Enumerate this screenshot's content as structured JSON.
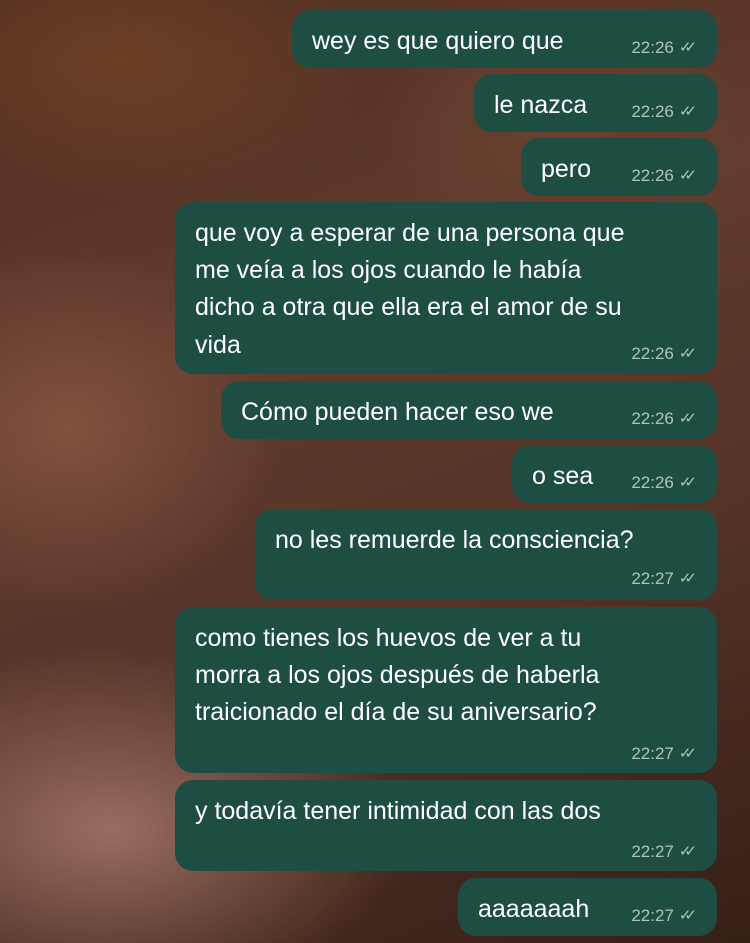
{
  "messages": [
    {
      "text": "wey es que quiero que",
      "time": "22:26",
      "status_icon": "double-check-icon"
    },
    {
      "text": "le nazca",
      "time": "22:26",
      "status_icon": "double-check-icon"
    },
    {
      "text": "pero",
      "time": "22:26",
      "status_icon": "double-check-icon"
    },
    {
      "lines": [
        "que voy a esperar de una persona que",
        "me veía a los ojos cuando le había",
        "dicho a otra que ella era el amor de su",
        "vida"
      ],
      "time": "22:26",
      "status_icon": "double-check-icon"
    },
    {
      "text": "Cómo pueden hacer eso we",
      "time": "22:26",
      "status_icon": "double-check-icon"
    },
    {
      "text": "o sea",
      "time": "22:26",
      "status_icon": "double-check-icon"
    },
    {
      "text": "no les remuerde la consciencia?",
      "time": "22:27",
      "status_icon": "double-check-icon"
    },
    {
      "lines": [
        "como tienes los huevos de ver a tu",
        "morra a los ojos después de haberla",
        "traicionado el día de su aniversario?"
      ],
      "time": "22:27",
      "status_icon": "double-check-icon"
    },
    {
      "text": "y todavía tener intimidad con las dos",
      "time": "22:27",
      "status_icon": "double-check-icon"
    },
    {
      "text": "aaaaaaah",
      "time": "22:27",
      "status_icon": "double-check-icon"
    }
  ],
  "colors": {
    "bubble": "#1e4d44",
    "text": "#ffffff",
    "meta": "#c8d8d2"
  }
}
